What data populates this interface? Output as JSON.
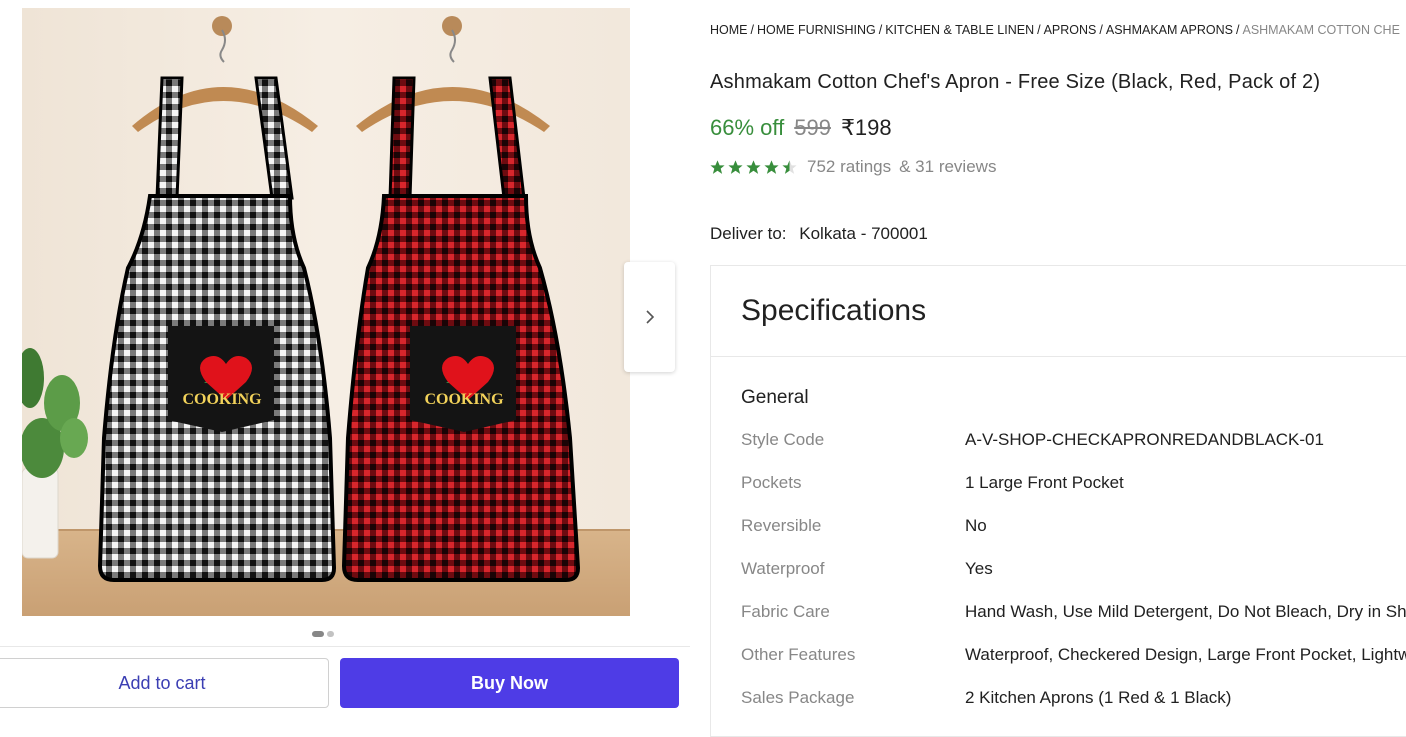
{
  "breadcrumb": [
    "HOME",
    "HOME FURNISHING",
    "KITCHEN & TABLE LINEN",
    "APRONS",
    "ASHMAKAM APRONS",
    "ASHMAKAM COTTON CHE"
  ],
  "product": {
    "title": "Ashmakam Cotton Chef's Apron - Free Size  (Black, Red, Pack of 2)",
    "discount": "66% off",
    "mrp": "599",
    "price": "₹198",
    "rating_stars": 4.5,
    "ratings": "752 ratings",
    "reviews": "& 31 reviews"
  },
  "delivery": {
    "label": "Deliver to:",
    "location": "Kolkata - 700001"
  },
  "image": {
    "pocket_line1": "I",
    "pocket_line2": "COOKING",
    "dots": 2,
    "active_dot": 0
  },
  "colors": {
    "discount_green": "#388e3c",
    "buy_button": "#4e3ce6",
    "cart_text": "#3b3eb3",
    "star_green": "#388e3c",
    "apron_red": "#c4161c",
    "apron_black": "#1a1a1a"
  },
  "actions": {
    "add_to_cart": "Add to cart",
    "buy_now": "Buy Now"
  },
  "icons": {
    "next": "chevron-right-icon",
    "star": "star-icon"
  },
  "specifications": {
    "title": "Specifications",
    "section": "General",
    "rows": [
      {
        "key": "Style Code",
        "value": "A-V-SHOP-CHECKAPRONREDANDBLACK-01"
      },
      {
        "key": "Pockets",
        "value": "1 Large Front Pocket"
      },
      {
        "key": "Reversible",
        "value": "No"
      },
      {
        "key": "Waterproof",
        "value": "Yes"
      },
      {
        "key": "Fabric Care",
        "value": "Hand Wash, Use Mild Detergent, Do Not Bleach, Dry in Sh"
      },
      {
        "key": "Other Features",
        "value": "Waterproof, Checkered Design, Large Front Pocket, Lightw"
      },
      {
        "key": "Sales Package",
        "value": "2 Kitchen Aprons (1 Red & 1 Black)"
      }
    ]
  }
}
